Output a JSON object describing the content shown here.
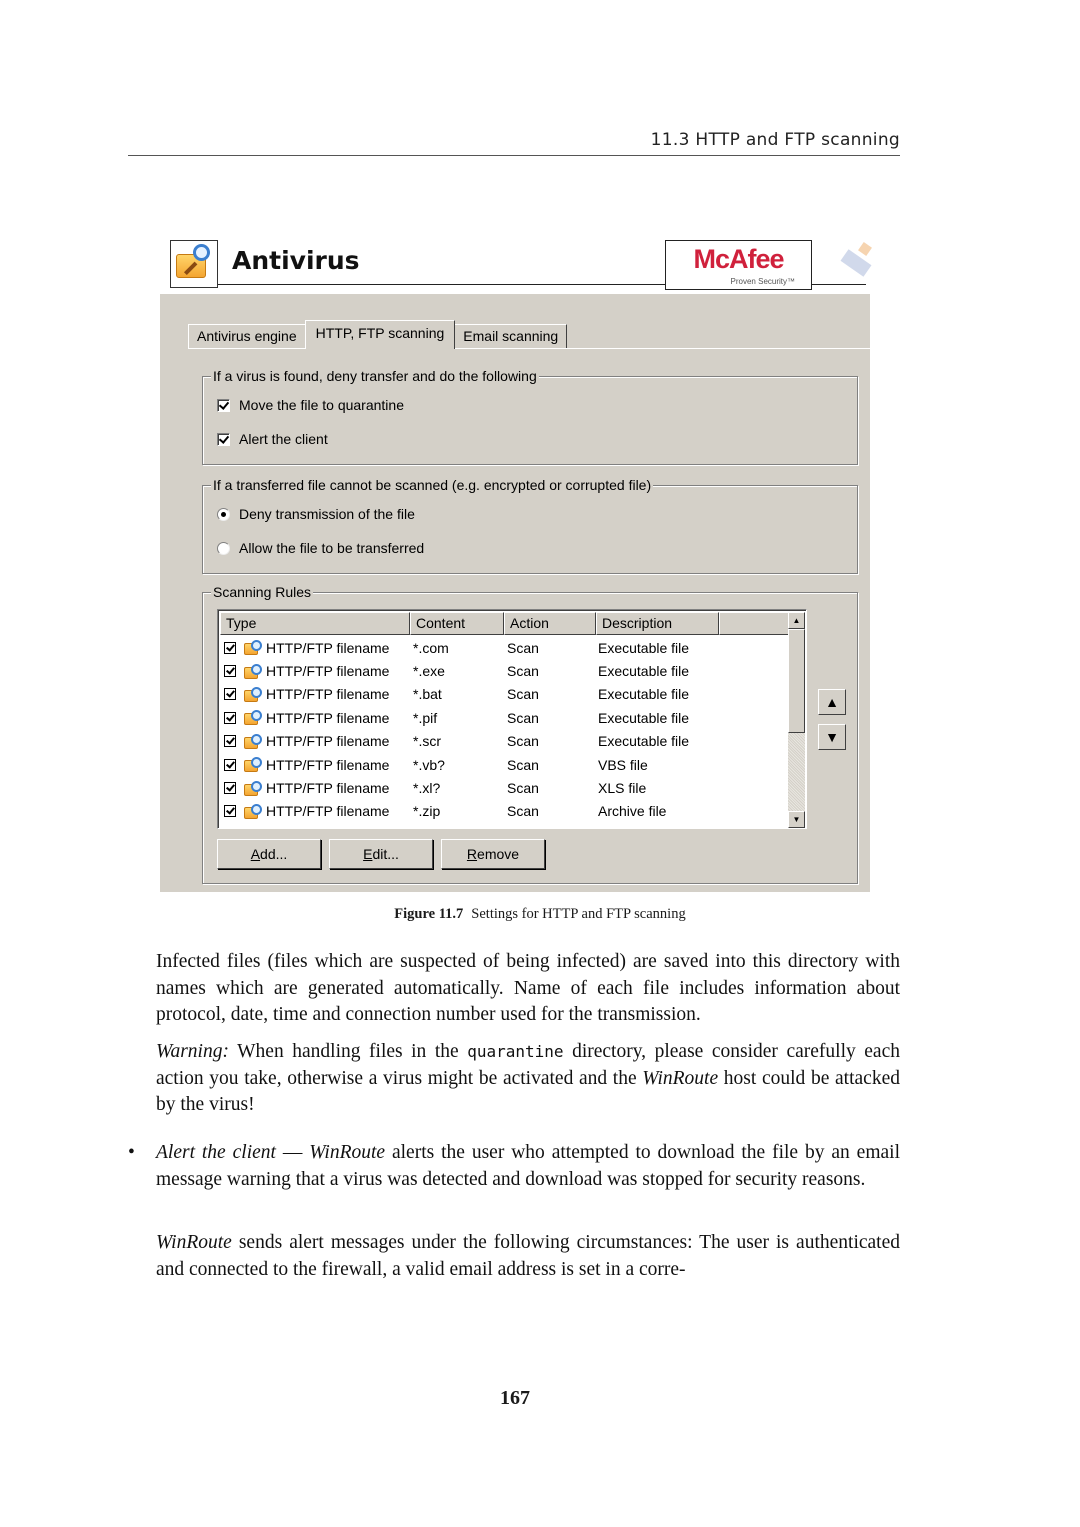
{
  "running_header": "11.3  HTTP and FTP scanning",
  "figure": {
    "window_title": "Antivirus",
    "icon": "antivirus-folder-magnifier-icon",
    "brand": {
      "name": "McAfee",
      "tagline": "Proven Security™",
      "color": "#d0213c"
    },
    "tabs": [
      {
        "label": "Antivirus engine",
        "active": false
      },
      {
        "label": "HTTP, FTP scanning",
        "active": true
      },
      {
        "label": "Email scanning",
        "active": false
      }
    ],
    "virus_found_group": {
      "legend": "If a virus is found, deny transfer and do the following",
      "options": [
        {
          "label": "Move the file to quarantine",
          "checked": true
        },
        {
          "label": "Alert the client",
          "checked": true
        }
      ]
    },
    "unscannable_group": {
      "legend": "If a transferred file cannot be scanned (e.g. encrypted or corrupted file)",
      "options": [
        {
          "label": "Deny transmission of the file",
          "selected": true
        },
        {
          "label": "Allow the file to be transferred",
          "selected": false
        }
      ]
    },
    "rules_group": {
      "legend": "Scanning Rules",
      "columns": [
        "Type",
        "Content",
        "Action",
        "Description"
      ],
      "rows": [
        {
          "checked": true,
          "type": "HTTP/FTP filename",
          "content": "*.com",
          "action": "Scan",
          "description": "Executable file"
        },
        {
          "checked": true,
          "type": "HTTP/FTP filename",
          "content": "*.exe",
          "action": "Scan",
          "description": "Executable file"
        },
        {
          "checked": true,
          "type": "HTTP/FTP filename",
          "content": "*.bat",
          "action": "Scan",
          "description": "Executable file"
        },
        {
          "checked": true,
          "type": "HTTP/FTP filename",
          "content": "*.pif",
          "action": "Scan",
          "description": "Executable file"
        },
        {
          "checked": true,
          "type": "HTTP/FTP filename",
          "content": "*.scr",
          "action": "Scan",
          "description": "Executable file"
        },
        {
          "checked": true,
          "type": "HTTP/FTP filename",
          "content": "*.vb?",
          "action": "Scan",
          "description": "VBS file"
        },
        {
          "checked": true,
          "type": "HTTP/FTP filename",
          "content": "*.xl?",
          "action": "Scan",
          "description": "XLS file"
        },
        {
          "checked": true,
          "type": "HTTP/FTP filename",
          "content": "*.zip",
          "action": "Scan",
          "description": "Archive file"
        }
      ],
      "buttons": {
        "add": {
          "mnemonic": "A",
          "rest": "dd..."
        },
        "edit": {
          "mnemonic": "E",
          "rest": "dit..."
        },
        "remove": {
          "mnemonic": "R",
          "rest": "emove"
        }
      },
      "move_up_glyph": "▲",
      "move_down_glyph": "▼",
      "scroll_up_glyph": "▲",
      "scroll_down_glyph": "▼"
    }
  },
  "caption": {
    "label": "Figure 11.7",
    "text": "Settings for HTTP and FTP scanning"
  },
  "body": {
    "p1": "Infected files (files which are suspected of being infected) are saved into this directory with names which are generated automatically.  Name of each file includes information about protocol, date, time and connection number used for the transmission.",
    "p2": {
      "lead": "Warning:",
      "before": " When handling files in the ",
      "code": "quarantine",
      "middle": " directory, please consider carefully each action you take, otherwise a virus might be activated and the ",
      "product": "WinRoute",
      "after": " host could be attacked by the virus!"
    },
    "p3": {
      "bullet": "•",
      "term": "Alert the client",
      "dash": " — ",
      "product": "WinRoute",
      "text": " alerts the user who attempted to download the file by an email message warning that a virus was detected and download was stopped for security reasons."
    },
    "p4": {
      "product": "WinRoute",
      "text": " sends alert messages under the following circumstances: The user is authenticated and connected to the firewall, a valid email address is set in a corre-"
    }
  },
  "page_number": "167"
}
